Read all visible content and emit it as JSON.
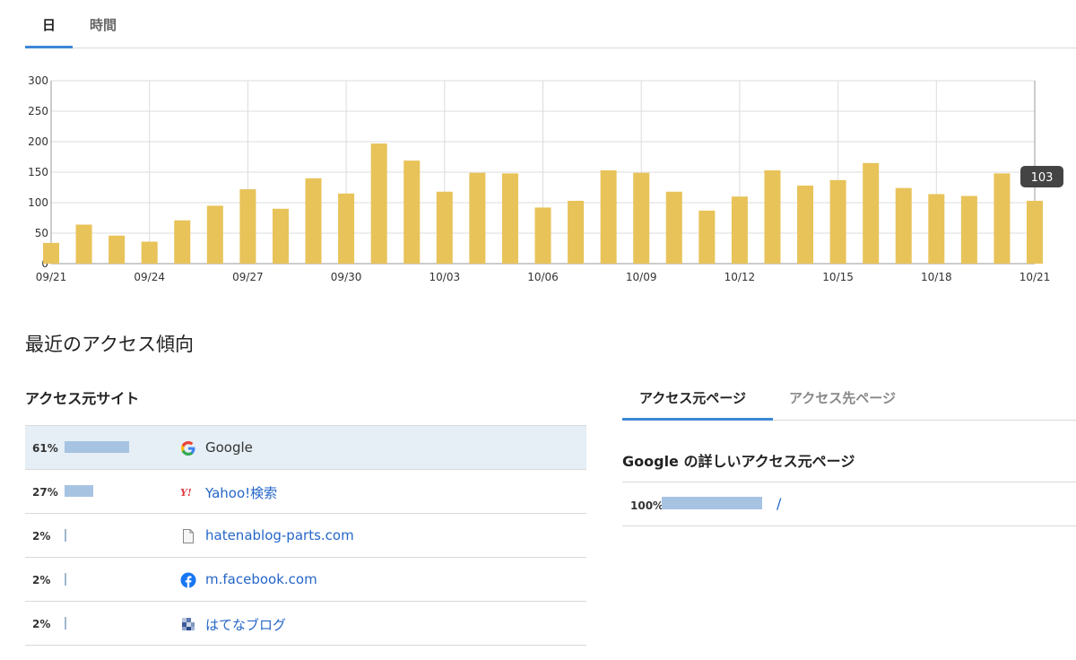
{
  "top_tabs": [
    {
      "label": "日",
      "active": true
    },
    {
      "label": "時間",
      "active": false
    }
  ],
  "chart_data": {
    "type": "bar",
    "categories": [
      "09/21",
      "09/22",
      "09/23",
      "09/24",
      "09/25",
      "09/26",
      "09/27",
      "09/28",
      "09/29",
      "09/30",
      "10/01",
      "10/02",
      "10/03",
      "10/04",
      "10/05",
      "10/06",
      "10/07",
      "10/08",
      "10/09",
      "10/10",
      "10/11",
      "10/12",
      "10/13",
      "10/14",
      "10/15",
      "10/16",
      "10/17",
      "10/18",
      "10/19",
      "10/20",
      "10/21"
    ],
    "values": [
      34,
      64,
      46,
      36,
      71,
      95,
      122,
      90,
      140,
      115,
      197,
      169,
      118,
      149,
      148,
      92,
      103,
      153,
      149,
      118,
      87,
      110,
      153,
      128,
      137,
      165,
      124,
      114,
      111,
      148,
      103
    ],
    "x_tick_labels": [
      "09/21",
      "09/24",
      "09/27",
      "09/30",
      "10/03",
      "10/06",
      "10/09",
      "10/12",
      "10/15",
      "10/18",
      "10/21"
    ],
    "y_ticks": [
      0,
      50,
      100,
      150,
      200,
      250,
      300
    ],
    "ylim": [
      0,
      300
    ],
    "grid": true,
    "bar_color": "#e8c359",
    "tooltip": {
      "category": "10/21",
      "value": 103
    }
  },
  "section_title": "最近のアクセス傾向",
  "access_sources": {
    "heading": "アクセス元サイト",
    "rows": [
      {
        "percent": "61%",
        "share": 61,
        "icon": "google-icon",
        "name": "Google",
        "highlighted": true
      },
      {
        "percent": "27%",
        "share": 27,
        "icon": "yahoo-icon",
        "name": "Yahoo!検索",
        "highlighted": false
      },
      {
        "percent": "2%",
        "share": 2,
        "icon": "document-icon",
        "name": "hatenablog-parts.com",
        "highlighted": false
      },
      {
        "percent": "2%",
        "share": 2,
        "icon": "facebook-icon",
        "name": "m.facebook.com",
        "highlighted": false
      },
      {
        "percent": "2%",
        "share": 2,
        "icon": "hatena-blog-icon",
        "name": "はてなブログ",
        "highlighted": false
      }
    ]
  },
  "right_panel": {
    "tabs": [
      {
        "label": "アクセス元ページ",
        "active": true
      },
      {
        "label": "アクセス先ページ",
        "active": false
      }
    ],
    "detail_heading": "Google の詳しいアクセス元ページ",
    "rows": [
      {
        "percent": "100%",
        "share": 100,
        "path": "/"
      }
    ]
  }
}
